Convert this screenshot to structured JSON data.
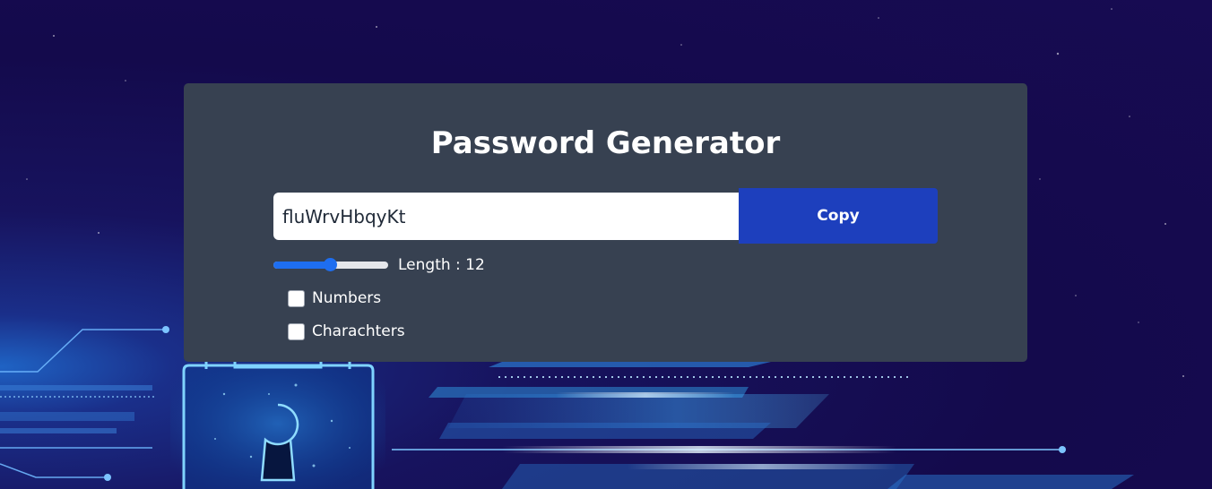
{
  "app": {
    "title": "Password Generator"
  },
  "password": {
    "value": "fluWrvHbqyKt"
  },
  "copy_button": {
    "label": "Copy"
  },
  "length": {
    "label": "Length : 12",
    "value": 12,
    "slider_fraction": 0.5
  },
  "options": [
    {
      "label": "Numbers",
      "checked": false
    },
    {
      "label": "Charachters",
      "checked": false
    }
  ],
  "colors": {
    "card": "#374151",
    "copy_button": "#1d3fbd",
    "slider_accent": "#1e6ef0"
  }
}
